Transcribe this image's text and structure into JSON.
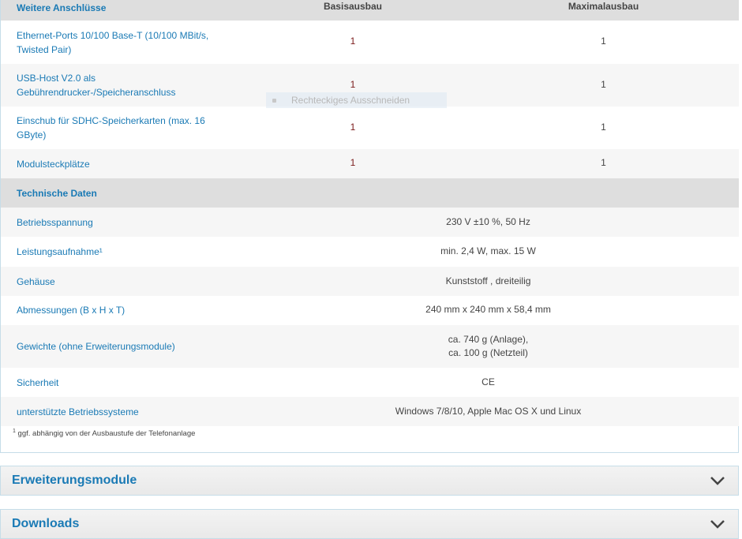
{
  "header": {
    "col1": "Weitere Anschlüsse",
    "col2": "Basisausbau",
    "col3": "Maximalausbau"
  },
  "anschluesse": [
    {
      "label": "Ethernet-Ports 10/100 Base-T (10/100 MBit/s, Twisted Pair)",
      "basis": "1",
      "max": "1"
    },
    {
      "label": "USB-Host V2.0 als Gebührendrucker-/Speicheranschluss",
      "basis": "1",
      "max": "1"
    },
    {
      "label": "Einschub für SDHC-Speicherkarten (max. 16 GByte)",
      "basis": "1",
      "max": "1"
    },
    {
      "label": "Modulsteckplätze",
      "basis": "1",
      "max": "1"
    }
  ],
  "technische_daten": {
    "title": "Technische Daten",
    "rows": [
      {
        "label": "Betriebsspannung",
        "value": "230 V ±10 %, 50 Hz"
      },
      {
        "label": "Leistungsaufnahme¹",
        "value": "min. 2,4 W, max. 15 W"
      },
      {
        "label": "Gehäuse",
        "value": "Kunststoff , dreiteilig"
      },
      {
        "label": "Abmessungen (B x H x T)",
        "value": "240 mm x 240 mm x 58,4 mm"
      },
      {
        "label": "Gewichte (ohne Erweiterungsmodule)",
        "value_line1": "ca. 740 g (Anlage),",
        "value_line2": "ca. 100 g (Netzteil)"
      },
      {
        "label": "Sicherheit",
        "value": "CE"
      },
      {
        "label": "unterstützte Betriebssysteme",
        "value": "Windows 7/8/10, Apple Mac OS X und Linux"
      }
    ]
  },
  "footnote": {
    "mark": "1",
    "text": "ggf. abhängig von der Ausbaustufe der Telefonanlage"
  },
  "overlay": {
    "text": "Rechteckiges Ausschneiden"
  },
  "accordion": [
    {
      "title": "Erweiterungsmodule",
      "icon": "chevron-down-icon"
    },
    {
      "title": "Downloads",
      "icon": "chevron-down-icon"
    }
  ],
  "colors": {
    "accent": "#1a7ab5",
    "section_bg": "#dedede",
    "row_alt": "#f6f6f6",
    "border": "#c6dde8"
  }
}
